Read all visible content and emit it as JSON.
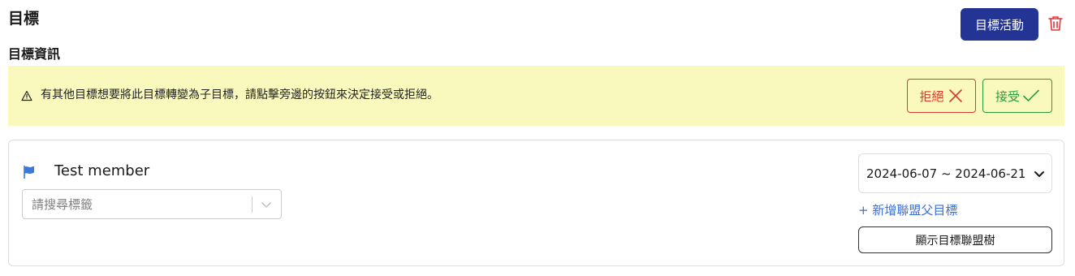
{
  "header": {
    "title": "目標",
    "activity_button_label": "目標活動",
    "delete_icon": "trash-icon"
  },
  "section": {
    "title": "目標資訊"
  },
  "alert": {
    "icon": "warning-icon",
    "message": "有其他目標想要將此目標轉變為子目標，請點擊旁邊的按鈕來決定接受或拒絕。",
    "reject_label": "拒絕",
    "accept_label": "接受",
    "background": "#f9f9be",
    "reject_color": "#d93a2b",
    "accept_color": "#2e9b3e"
  },
  "goal": {
    "flag_icon": "flag-icon",
    "member_name": "Test member",
    "tag_placeholder": "請搜尋標籤",
    "date_range": "2024-06-07 ~ 2024-06-21",
    "add_parent_label": "+ 新增聯盟父目標",
    "show_tree_label": "顯示目標聯盟樹"
  },
  "colors": {
    "primary": "#233494",
    "link": "#3b6fd6",
    "flag": "#3b7bd6"
  }
}
